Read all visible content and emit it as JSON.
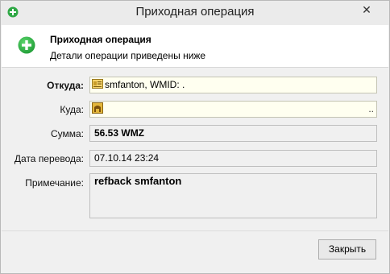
{
  "window": {
    "title": "Приходная операция",
    "close_glyph": "✕"
  },
  "header": {
    "title": "Приходная операция",
    "subtitle": "Детали операции приведены ниже"
  },
  "form": {
    "from_label": "Откуда:",
    "from_value": "smfanton, WMID: .",
    "to_label": "Куда:",
    "to_value": "",
    "to_dots": "..",
    "amount_label": "Сумма:",
    "amount_value": "56.53 WMZ",
    "date_label": "Дата перевода:",
    "date_value": "07.10.14 23:24",
    "note_label": "Примечание:",
    "note_value": "refback smfanton"
  },
  "buttons": {
    "close_label": "Закрыть"
  },
  "icons": {
    "app": "green-plus-icon",
    "header": "green-plus-icon",
    "from": "id-card-icon",
    "to": "purse-icon"
  },
  "colors": {
    "accent_green": "#2fa845",
    "input_bg": "#fffff0",
    "readonly_bg": "#f0f0f0"
  }
}
